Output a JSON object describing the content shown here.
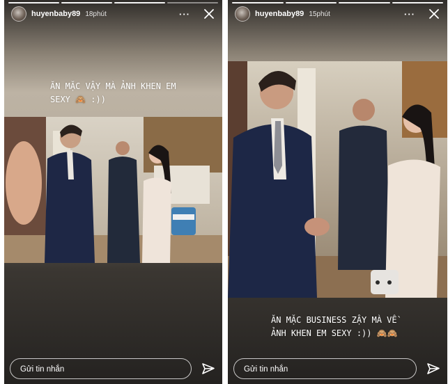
{
  "stories": [
    {
      "username": "huyenbaby89",
      "time": "18phút",
      "more_icon": "more-horizontal-icon",
      "close_icon": "close-icon",
      "caption_line1": "ĂN MẶC VẬY MÀ ẢNH KHEN EM",
      "caption_line2": "SEXY 🙈 :))",
      "message_placeholder": "Gửi tin nhắn",
      "send_icon": "send-icon"
    },
    {
      "username": "huyenbaby89",
      "time": "15phút",
      "more_icon": "more-horizontal-icon",
      "close_icon": "close-icon",
      "caption_line1": "ĂN MẶC BUSINESS ZẬY MÀ VỀ",
      "caption_line2": "ẢNH KHEN EM SEXY :)) 🙈🙈",
      "message_placeholder": "Gửi tin nhắn",
      "send_icon": "send-icon"
    }
  ]
}
